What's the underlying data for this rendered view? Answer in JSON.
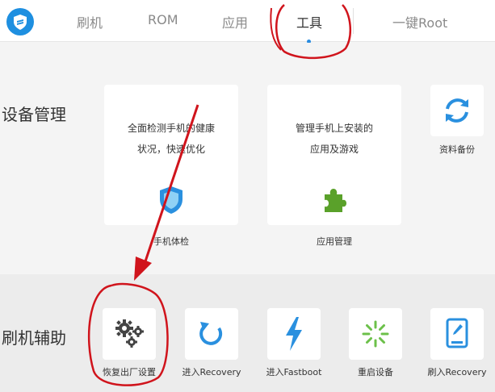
{
  "nav": {
    "items": [
      "刷机",
      "ROM",
      "应用",
      "工具",
      "一键Root"
    ],
    "active_index": 3
  },
  "device_management": {
    "title": "设备管理",
    "cards": [
      {
        "desc_line1": "全面检测手机的健康",
        "desc_line2": "状况，快速优化",
        "label": "手机体检",
        "icon": "shield-icon"
      },
      {
        "desc_line1": "管理手机上安装的",
        "desc_line2": "应用及游戏",
        "label": "应用管理",
        "icon": "puzzle-icon"
      },
      {
        "label": "资料备份",
        "icon": "sync-icon"
      }
    ]
  },
  "flash_assist": {
    "title": "刷机辅助",
    "tools": [
      {
        "label": "恢复出厂设置",
        "icon": "gears-icon"
      },
      {
        "label": "进入Recovery",
        "icon": "refresh-icon"
      },
      {
        "label": "进入Fastboot",
        "icon": "lightning-icon"
      },
      {
        "label": "重启设备",
        "icon": "loading-icon"
      },
      {
        "label": "刷入Recovery",
        "icon": "tablet-edit-icon"
      }
    ]
  },
  "colors": {
    "accent": "#1e8fe0",
    "annotation": "#d0141c",
    "puzzle": "#5aa12a"
  }
}
